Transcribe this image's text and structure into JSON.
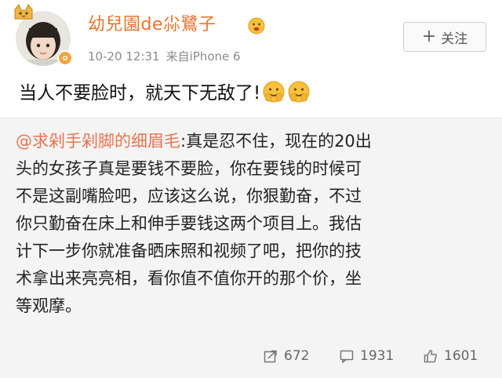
{
  "post": {
    "username": "幼兒園de尛鷺子",
    "timestamp": "10-20 12:31",
    "source": "来自iPhone 6",
    "text": "当人不要脸时，就天下无敌了!",
    "follow_label": "关注",
    "follow_icon": "plus-icon",
    "username_color": "#e8732a"
  },
  "retweet": {
    "mention": "@求剁手剁脚的细眉毛",
    "lines": [
      ":真是忍不住，现在的20出",
      "头的女孩子真是要钱不要脸，你在要钱的时候可",
      "不是这副嘴脸吧，应该这么说，你狠勤奋，不过",
      "你只勤奋在床上和伸手要钱这两个项目上。我估",
      "计下一步你就准备晒床照和视频了吧，把你的技",
      "术拿出来亮亮相，看你值不值你开的那个价，坐",
      "等观摩。"
    ],
    "mention_color": "#eb7350"
  },
  "actions": {
    "repost_count": "672",
    "comment_count": "1931",
    "like_count": "1601",
    "repost_icon": "repost-icon",
    "comment_icon": "comment-icon",
    "like_icon": "thumbs-up-icon"
  }
}
